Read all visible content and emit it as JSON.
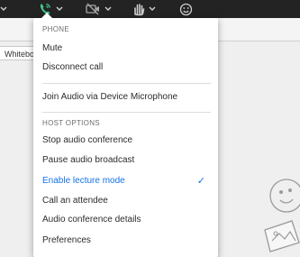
{
  "tabs": {
    "whiteboard_label": "Whiteboard"
  },
  "icons": {
    "phone": "phone-icon",
    "camera_off": "camera-off-icon",
    "raise_hand": "raise-hand-icon",
    "emoji": "emoji-icon",
    "chevron": "chevron-down-icon",
    "checkmark": "checkmark-icon"
  },
  "colors": {
    "topbar": "#232323",
    "phone_active": "#3fcf8e",
    "accent": "#1473e6"
  },
  "menu": {
    "phone_header": "PHONE",
    "mute": "Mute",
    "disconnect": "Disconnect call",
    "join_audio": "Join Audio via Device Microphone",
    "host_header": "HOST OPTIONS",
    "stop_conference": "Stop audio conference",
    "pause_broadcast": "Pause audio broadcast",
    "lecture_mode": "Enable lecture mode",
    "call_attendee": "Call an attendee",
    "conference_details": "Audio conference details",
    "preferences": "Preferences",
    "lecture_mode_checked": true
  }
}
